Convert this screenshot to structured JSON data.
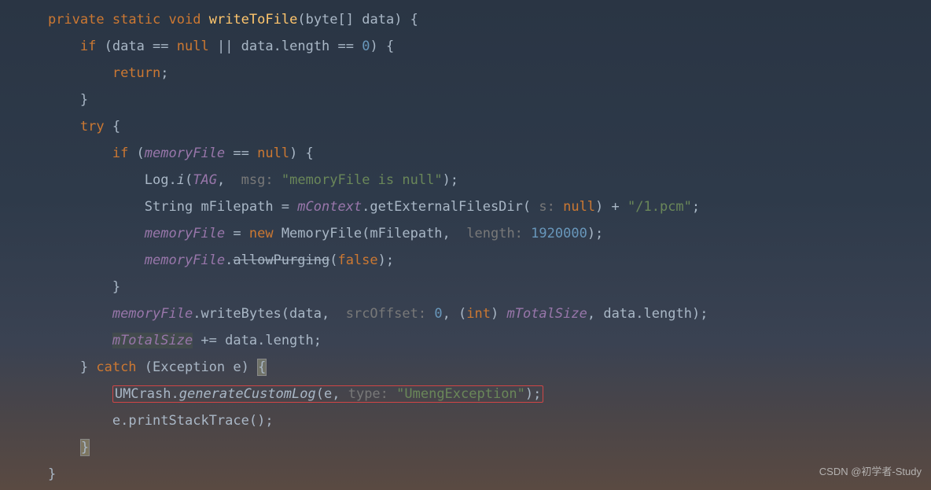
{
  "code": {
    "kw_private": "private",
    "kw_static": "static",
    "kw_void": "void",
    "method_name": "writeToFile",
    "param_type": "byte[]",
    "param_name": "data",
    "kw_if": "if",
    "kw_null": "null",
    "length_prop": "length",
    "zero": "0",
    "kw_return": "return",
    "kw_try": "try",
    "field_memoryFile": "memoryFile",
    "log_class": "Log",
    "log_i": "i",
    "tag_field": "TAG",
    "hint_msg": "msg: ",
    "str_memnull": "\"memoryFile is null\"",
    "string_type": "String",
    "mfilepath": "mFilepath",
    "eq": " = ",
    "mcontext_field": "mContext",
    "getext": "getExternalFilesDir",
    "hint_s": " s: ",
    "plus": " + ",
    "str_pcm": "\"/1.pcm\"",
    "kw_new": "new",
    "memfile_type": "MemoryFile",
    "hint_length": "length: ",
    "num_1920000": "1920000",
    "allowpurging": "allowPurging",
    "kw_false": "false",
    "writebytes": "writeBytes",
    "hint_srcoff": "srcOffset: ",
    "kw_int": "int",
    "mtotalsize_field": "mTotalSize",
    "pluseq": " += ",
    "kw_catch": "catch",
    "exception_type": "Exception",
    "exc_var": "e",
    "umcrash": "UMCrash",
    "gencustom": "generateCustomLog",
    "hint_type": "type: ",
    "str_umeng": "\"UmengException\"",
    "printstack": "printStackTrace"
  },
  "watermark": "CSDN @初学者-Study"
}
